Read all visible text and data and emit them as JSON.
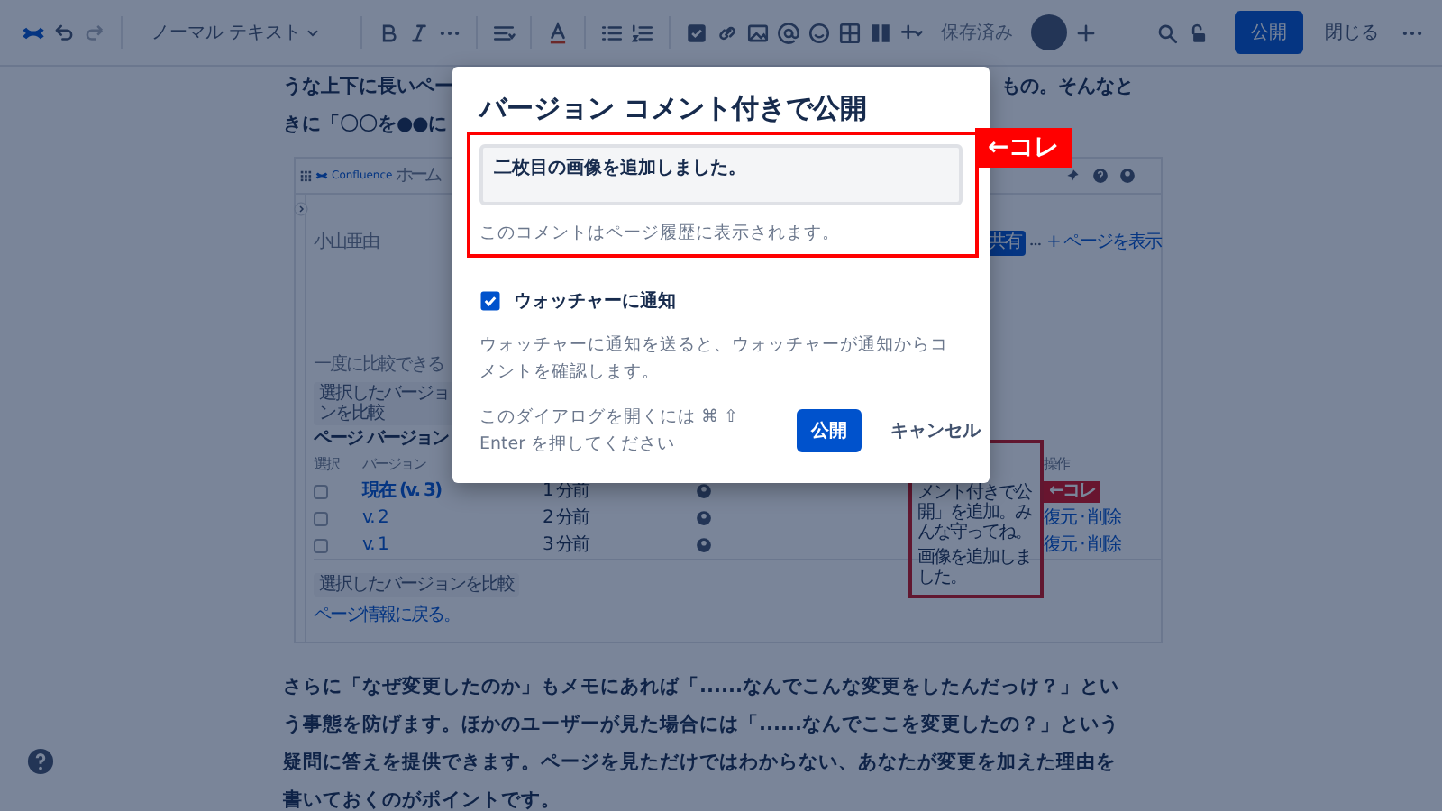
{
  "toolbar": {
    "text_style": "ノーマル テキスト",
    "save_status": "保存済み",
    "publish_button": "公開",
    "close_button": "閉じる"
  },
  "article": {
    "top_lines": [
      {
        "left": "うな上下に長いペー",
        "right": "もの。そんなと"
      },
      {
        "left": "きに「〇〇を●●に"
      }
    ],
    "screenshot": {
      "app_name": "Confluence",
      "nav_item": "ホーム",
      "author": "小山亜由",
      "share_button": "共有",
      "view_page_link": "+ ページを表示",
      "compare_note": "一度に比較できる",
      "compare_button": "選択したバージョンを比較",
      "heading": "ページ バージョン",
      "columns": [
        "選択",
        "バージョン",
        "操作"
      ],
      "versions": [
        {
          "version": "現在 (v. 3)",
          "time": "1 分前",
          "checked": false,
          "current": true
        },
        {
          "version": "v. 2",
          "time": "2 分前",
          "checked": false,
          "current": false,
          "actions": "復元 · 削除"
        },
        {
          "version": "v. 1",
          "time": "3 分前",
          "checked": false,
          "current": false,
          "actions": "復元 · 削除"
        }
      ],
      "comments": [
        "メント付きで公開」を追加。みんな守ってね。",
        "画像を追加しました。"
      ],
      "annotation_label": "←コレ",
      "bottom_compare_button": "選択したバージョンを比較",
      "back_link": "ページ情報に戻る。"
    },
    "bottom_paragraph": "さらに「なぜ変更したのか」もメモにあれば「......なんでこんな変更をしたんだっけ？」という事態を防げます。ほかのユーザーが見た場合には「......なんでここを変更したの？」という疑問に答えを提供できます。ページを見ただけではわからない、あなたが変更を加えた理由を書いておくのがポイントです。"
  },
  "dialog": {
    "title": "バージョン コメント付きで公開",
    "comment": {
      "value": "二枚目の画像を追加しました。",
      "hint": "このコメントはページ履歴に表示されます。"
    },
    "notify": {
      "label": "ウォッチャーに通知",
      "checked": true
    },
    "notify_description": "ウォッチャーに通知を送ると、ウォッチャーが通知からコメントを確認します。",
    "shortcut_hint": "このダイアログを開くには ⌘ ⇧ Enter を押してください",
    "buttons": [
      {
        "label": "公開",
        "kind": "primary"
      },
      {
        "label": "キャンセル",
        "kind": "subtle"
      }
    ]
  },
  "annotation": {
    "label": "←コレ"
  }
}
